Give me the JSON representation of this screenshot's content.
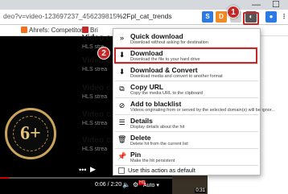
{
  "browser": {
    "url_prefix": "deo?v=video-123697237_456239815",
    "url_suffix": "%2Fpl_cat_trends",
    "window_controls": [
      "—",
      "☐"
    ],
    "extensions": [
      {
        "name": "shield-icon",
        "color": "#2c7be5",
        "label": "S"
      },
      {
        "name": "orange-ext-icon",
        "color": "#f08a24",
        "label": "D"
      },
      {
        "name": "video-downloadhelper-icon",
        "color": "#4a4a4a",
        "label": "◐"
      },
      {
        "name": "ext-dark-icon",
        "color": "#333333",
        "label": "✎"
      }
    ]
  },
  "bookmarks": [
    {
      "label": "Ahrefs: Competitor S",
      "color": "#f2711c"
    },
    {
      "label": "Bri",
      "color": "#c62828"
    }
  ],
  "video": {
    "logo_text": "6+",
    "time": "0:06 / 2:20",
    "auto_label": "Auto",
    "hd_label": "HD",
    "progress": 0.05
  },
  "sidebar": {
    "items": [
      {
        "title": "Video c",
        "sub": "HLS stre"
      },
      {
        "title": "Video cat",
        "sub": "HLS strea"
      },
      {
        "title": "Video cat",
        "sub": "HLS strea"
      },
      {
        "title": "Video cat",
        "sub": "HLS strea"
      },
      {
        "title": "Video cat",
        "sub": "HLS strea"
      }
    ],
    "thumb_time": "0:31"
  },
  "menu": {
    "items": [
      {
        "icon": "»",
        "icon_name": "quick-download-icon",
        "title": "Quick download",
        "desc": "Download without asking for destination"
      },
      {
        "icon": "⬇",
        "icon_name": "download-icon",
        "title": "Download",
        "desc": "Download the file to your hard drive"
      },
      {
        "icon": "⬇",
        "icon_name": "download-convert-icon",
        "title": "Download & Convert",
        "desc": "Download media and convert to another format"
      },
      {
        "icon": "⧉",
        "icon_name": "copy-url-icon",
        "title": "Copy URL",
        "desc": "Copy the media URL to the clipboard"
      },
      {
        "icon": "⊘",
        "icon_name": "blacklist-icon",
        "title": "Add to blacklist",
        "desc": "Videos originating from or served by the selected domain(s) will be ignor..."
      },
      {
        "icon": "☰",
        "icon_name": "details-icon",
        "title": "Details",
        "desc": "Display details about the hit"
      },
      {
        "icon": "🗑",
        "icon_name": "delete-icon",
        "title": "Delete",
        "desc": "Delete hit from the current list"
      },
      {
        "icon": "📌",
        "icon_name": "pin-icon",
        "title": "Pin",
        "desc": "Make the hit persistent"
      }
    ],
    "default_checkbox_label": "Use this action as default"
  },
  "annotations": {
    "badge1": "1",
    "badge2": "2",
    "color": "#c62828"
  }
}
